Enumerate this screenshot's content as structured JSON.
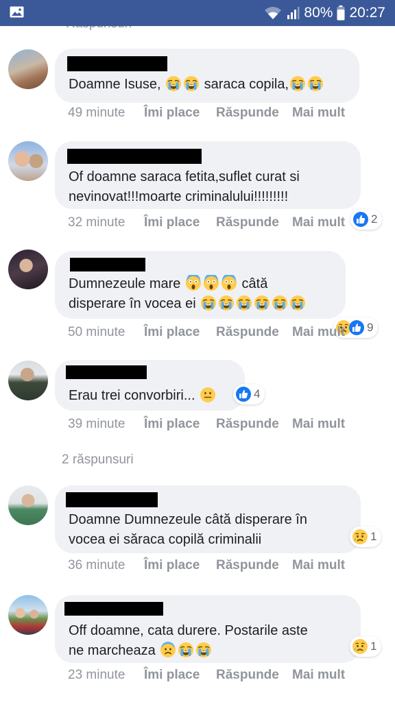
{
  "status_bar": {
    "battery": "80%",
    "time": "20:27"
  },
  "feed": {
    "cut_label": "Răspunsuri",
    "replies_label": "2 răspunsuri",
    "actions": {
      "like": "Îmi place",
      "reply": "Răspunde",
      "more": "Mai mult"
    },
    "comments": [
      {
        "line1": "Doamne Isuse,",
        "line1b": "saraca copila,",
        "time": "49 minute",
        "react_count": ""
      },
      {
        "line1": "Of doamne saraca fetita,suflet curat si",
        "line2": "nevinovat!!!moarte criminalului!!!!!!!!!",
        "time": "32 minute",
        "react_count": "2"
      },
      {
        "line1": "Dumnezeule mare",
        "line1b": "câtă",
        "line2": "disperare în vocea ei",
        "time": "50 minute",
        "react_count": "9"
      },
      {
        "line1": "Erau trei convorbiri...",
        "time": "39 minute",
        "react_count": "4"
      },
      {
        "line1": "Doamne Dumnezeule câtă disperare în",
        "line2": "vocea ei săraca copilă criminalii",
        "time": "36 minute",
        "react_count": "1"
      },
      {
        "line1": "Off doamne, cata durere. Postarile aste",
        "line2": "ne marcheaza",
        "time": "23 minute",
        "react_count": "1"
      }
    ]
  },
  "colors": {
    "header": "#3b5998",
    "bubble": "#f0f1f4",
    "meta_text": "#90949c",
    "like_blue": "#1877f2",
    "emoji_yellow": "#ffcc4d"
  },
  "icons": [
    "image-icon",
    "wifi-icon",
    "signal-icon",
    "battery-icon",
    "crying-emoji",
    "scream-emoji",
    "slight-smile-emoji",
    "fearful-emoji",
    "sad-tear-emoji",
    "like-reaction-icon"
  ]
}
